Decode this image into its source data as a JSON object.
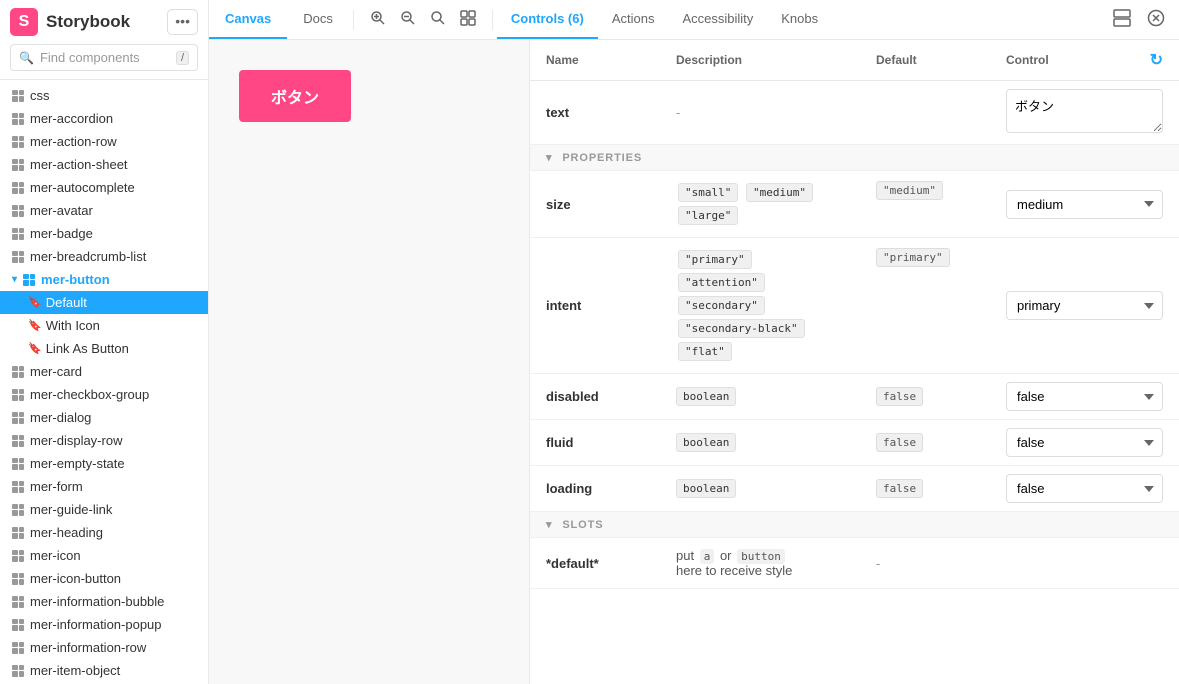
{
  "sidebar": {
    "logo": "Storybook",
    "logo_icon": "S",
    "menu_icon": "•••",
    "search_placeholder": "Find components",
    "search_slash": "/",
    "items": [
      {
        "id": "css",
        "label": "css",
        "indent": 0
      },
      {
        "id": "mer-accordion",
        "label": "mer-accordion",
        "indent": 0
      },
      {
        "id": "mer-action-row",
        "label": "mer-action-row",
        "indent": 0
      },
      {
        "id": "mer-action-sheet",
        "label": "mer-action-sheet",
        "indent": 0
      },
      {
        "id": "mer-autocomplete",
        "label": "mer-autocomplete",
        "indent": 0
      },
      {
        "id": "mer-avatar",
        "label": "mer-avatar",
        "indent": 0
      },
      {
        "id": "mer-badge",
        "label": "mer-badge",
        "indent": 0
      },
      {
        "id": "mer-breadcrumb-list",
        "label": "mer-breadcrumb-list",
        "indent": 0
      },
      {
        "id": "mer-button",
        "label": "mer-button",
        "indent": 0,
        "expanded": true
      },
      {
        "id": "default",
        "label": "Default",
        "indent": 1,
        "active": true,
        "bookmark": true
      },
      {
        "id": "with-icon",
        "label": "With Icon",
        "indent": 1,
        "bookmark": true
      },
      {
        "id": "link-as-button",
        "label": "Link As Button",
        "indent": 1,
        "bookmark": true
      },
      {
        "id": "mer-card",
        "label": "mer-card",
        "indent": 0
      },
      {
        "id": "mer-checkbox-group",
        "label": "mer-checkbox-group",
        "indent": 0
      },
      {
        "id": "mer-dialog",
        "label": "mer-dialog",
        "indent": 0
      },
      {
        "id": "mer-display-row",
        "label": "mer-display-row",
        "indent": 0
      },
      {
        "id": "mer-empty-state",
        "label": "mer-empty-state",
        "indent": 0
      },
      {
        "id": "mer-form",
        "label": "mer-form",
        "indent": 0
      },
      {
        "id": "mer-guide-link",
        "label": "mer-guide-link",
        "indent": 0
      },
      {
        "id": "mer-heading",
        "label": "mer-heading",
        "indent": 0
      },
      {
        "id": "mer-icon",
        "label": "mer-icon",
        "indent": 0
      },
      {
        "id": "mer-icon-button",
        "label": "mer-icon-button",
        "indent": 0
      },
      {
        "id": "mer-information-bubble",
        "label": "mer-information-bubble",
        "indent": 0
      },
      {
        "id": "mer-information-popup",
        "label": "mer-information-popup",
        "indent": 0
      },
      {
        "id": "mer-information-row",
        "label": "mer-information-row",
        "indent": 0
      },
      {
        "id": "mer-item-object",
        "label": "mer-item-object",
        "indent": 0
      }
    ]
  },
  "tabs": {
    "items": [
      {
        "id": "canvas",
        "label": "Canvas",
        "active": false
      },
      {
        "id": "docs",
        "label": "Docs",
        "active": false
      }
    ],
    "controls_label": "Controls (6)",
    "actions_label": "Actions",
    "accessibility_label": "Accessibility",
    "knobs_label": "Knobs"
  },
  "canvas": {
    "button_label": "ボタン"
  },
  "controls": {
    "col_name": "Name",
    "col_description": "Description",
    "col_default": "Default",
    "col_control": "Control",
    "text_row": {
      "name": "text",
      "description": "-",
      "default": "",
      "value": "ボタン"
    },
    "properties_section": "PROPERTIES",
    "size_row": {
      "name": "size",
      "tags": [
        "\"small\"",
        "\"medium\"",
        "\"large\""
      ],
      "default_tag": "\"medium\"",
      "value": "medium"
    },
    "intent_row": {
      "name": "intent",
      "tags": [
        "\"primary\"",
        "\"attention\"",
        "\"secondary\"",
        "\"secondary-black\"",
        "\"flat\""
      ],
      "default_tag": "\"primary\"",
      "value": "primary"
    },
    "disabled_row": {
      "name": "disabled",
      "type": "boolean",
      "default_val": "false",
      "value": "false"
    },
    "fluid_row": {
      "name": "fluid",
      "type": "boolean",
      "default_val": "false",
      "value": "false"
    },
    "loading_row": {
      "name": "loading",
      "type": "boolean",
      "default_val": "false",
      "value": "false"
    },
    "slots_section": "SLOTS",
    "default_slot": {
      "name": "*default*",
      "description_pre": "put",
      "description_code1": "a",
      "description_mid": "or",
      "description_code2": "button",
      "description_post": "here to receive style",
      "default_val": "-"
    },
    "select_options": {
      "boolean": [
        "false",
        "true"
      ]
    }
  }
}
